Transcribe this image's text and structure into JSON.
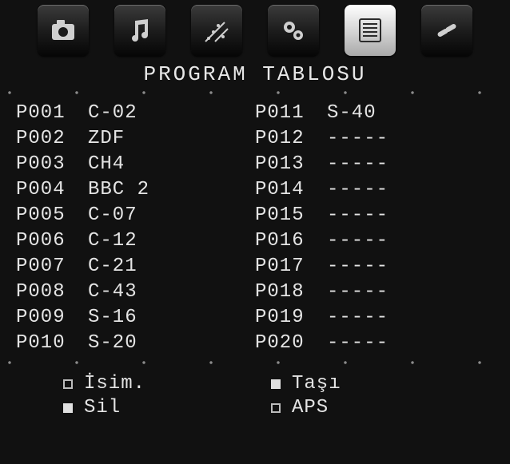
{
  "title": "PROGRAM TABLOSU",
  "tabs": [
    {
      "id": "picture",
      "selected": false
    },
    {
      "id": "sound",
      "selected": false
    },
    {
      "id": "feature",
      "selected": false
    },
    {
      "id": "install",
      "selected": false
    },
    {
      "id": "program",
      "selected": true
    },
    {
      "id": "source",
      "selected": false
    }
  ],
  "programs_left": [
    {
      "num": "P001",
      "name": "C-02"
    },
    {
      "num": "P002",
      "name": "ZDF"
    },
    {
      "num": "P003",
      "name": "CH4"
    },
    {
      "num": "P004",
      "name": "BBC 2"
    },
    {
      "num": "P005",
      "name": "C-07"
    },
    {
      "num": "P006",
      "name": "C-12"
    },
    {
      "num": "P007",
      "name": "C-21"
    },
    {
      "num": "P008",
      "name": "C-43"
    },
    {
      "num": "P009",
      "name": "S-16"
    },
    {
      "num": "P010",
      "name": "S-20"
    }
  ],
  "programs_right": [
    {
      "num": "P011",
      "name": "S-40"
    },
    {
      "num": "P012",
      "name": "-----"
    },
    {
      "num": "P013",
      "name": "-----"
    },
    {
      "num": "P014",
      "name": "-----"
    },
    {
      "num": "P015",
      "name": "-----"
    },
    {
      "num": "P016",
      "name": "-----"
    },
    {
      "num": "P017",
      "name": "-----"
    },
    {
      "num": "P018",
      "name": "-----"
    },
    {
      "num": "P019",
      "name": "-----"
    },
    {
      "num": "P020",
      "name": "-----"
    }
  ],
  "legend": {
    "name": "İsim.",
    "move": "Taşı",
    "delete": "Sil",
    "aps": "APS"
  }
}
